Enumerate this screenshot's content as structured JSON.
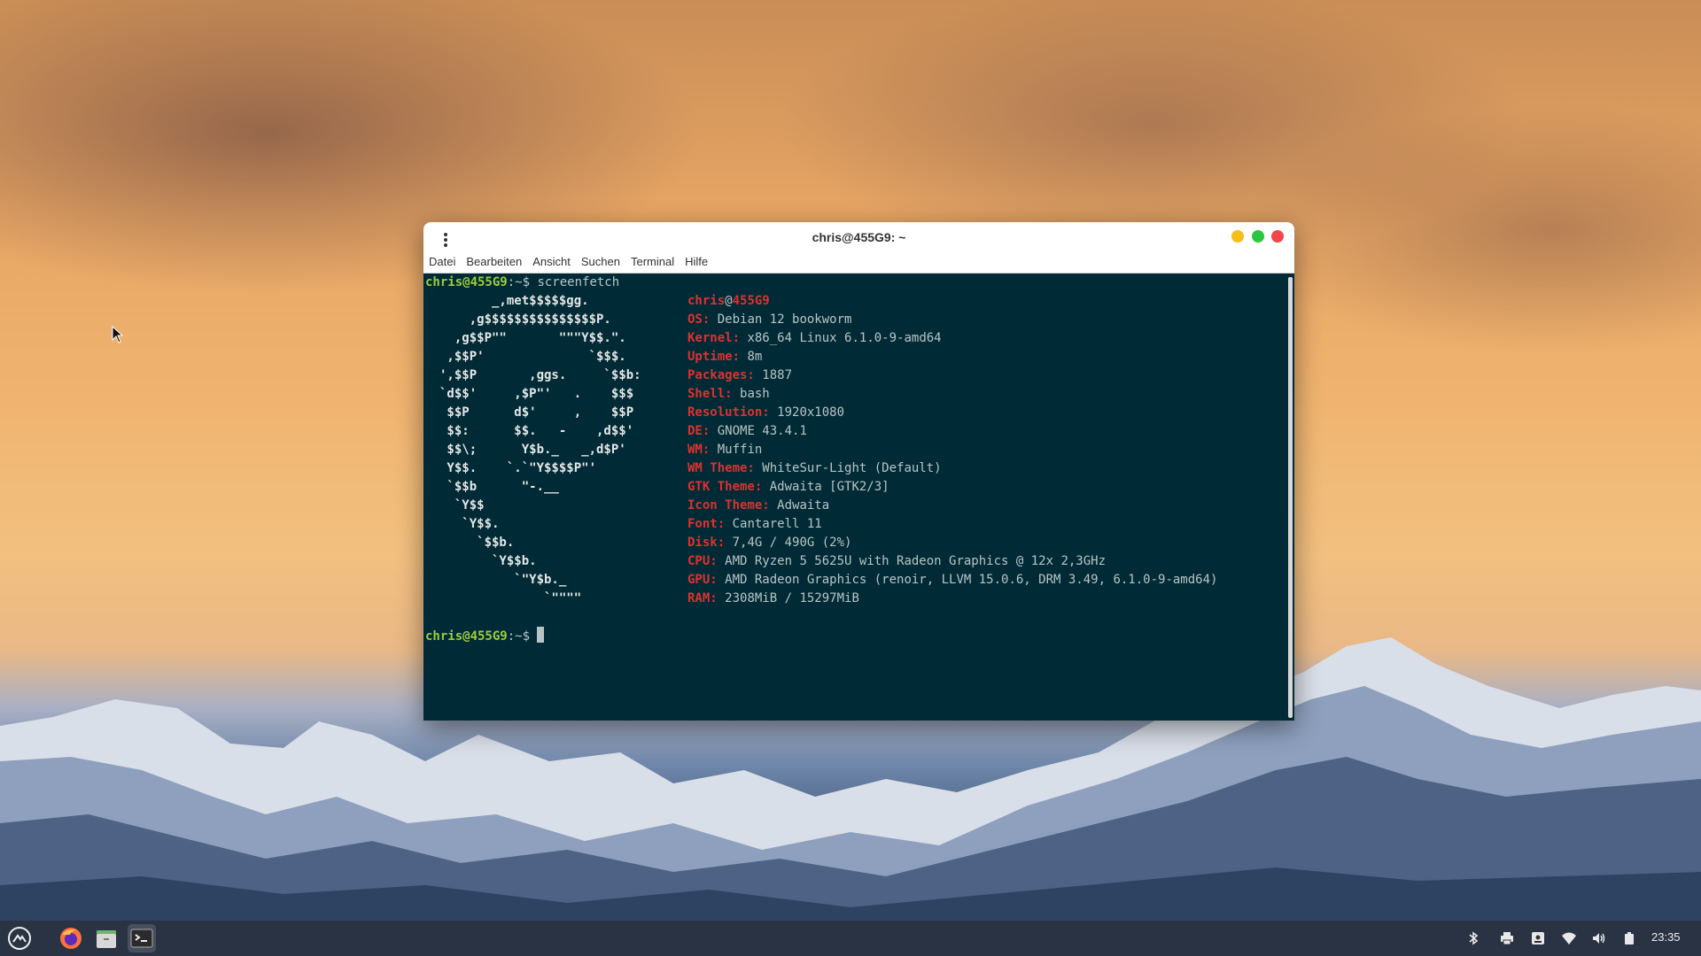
{
  "terminal": {
    "title": "chris@455G9: ~",
    "menu": [
      "Datei",
      "Bearbeiten",
      "Ansicht",
      "Suchen",
      "Terminal",
      "Hilfe"
    ],
    "prompt_user": "chris@455G9",
    "prompt_sep": ":~",
    "prompt_symbol": "$",
    "command": "screenfetch",
    "logo": [
      "       _,met$$$$$gg.",
      "    ,g$$$$$$$$$$$$$$$P.",
      "  ,g$$P\"\"       \"\"\"Y$$.\".",
      " ,$$P'              `$$$.",
      "',$$P       ,ggs.     `$$b:",
      "`d$$'     ,$P\"'   .    $$$",
      " $$P      d$'     ,    $$P",
      " $$:      $$.   -    ,d$$'",
      " $$\\;      Y$b._   _,d$P'",
      " Y$$.    `.`\"Y$$$$P\"'",
      " `$$b      \"-.__",
      "  `Y$$",
      "   `Y$$.",
      "     `$$b.",
      "       `Y$$b.",
      "          `\"Y$b._",
      "              `\"\"\"\""
    ],
    "host_user": "chris",
    "host_at": "@",
    "host_name": "455G9",
    "info": [
      {
        "key": "OS:",
        "value": "Debian 12 bookworm"
      },
      {
        "key": "Kernel:",
        "value": "x86_64 Linux 6.1.0-9-amd64"
      },
      {
        "key": "Uptime:",
        "value": "8m"
      },
      {
        "key": "Packages:",
        "value": "1887"
      },
      {
        "key": "Shell:",
        "value": "bash"
      },
      {
        "key": "Resolution:",
        "value": "1920x1080"
      },
      {
        "key": "DE:",
        "value": "GNOME 43.4.1"
      },
      {
        "key": "WM:",
        "value": "Muffin"
      },
      {
        "key": "WM Theme:",
        "value": "WhiteSur-Light (Default)"
      },
      {
        "key": "GTK Theme:",
        "value": "Adwaita [GTK2/3]"
      },
      {
        "key": "Icon Theme:",
        "value": "Adwaita"
      },
      {
        "key": "Font:",
        "value": "Cantarell 11"
      },
      {
        "key": "Disk:",
        "value": "7,4G / 490G (2%)"
      },
      {
        "key": "CPU:",
        "value": "AMD Ryzen 5 5625U with Radeon Graphics @ 12x 2,3GHz"
      },
      {
        "key": "GPU:",
        "value": "AMD Radeon Graphics (renoir, LLVM 15.0.6, DRM 3.49, 6.1.0-9-amd64)"
      },
      {
        "key": "RAM:",
        "value": "2308MiB / 15297MiB"
      }
    ]
  },
  "taskbar": {
    "apps": [
      "menu-icon",
      "firefox-icon",
      "files-icon",
      "terminal-icon"
    ],
    "tray": [
      "bluetooth-icon",
      "printer-icon",
      "notes-icon",
      "wifi-icon",
      "volume-icon",
      "battery-icon"
    ],
    "clock": "23:35"
  },
  "colors": {
    "terminal_bg": "#002b36",
    "prompt_green": "#9ccc3d",
    "key_red": "#dc322f"
  }
}
